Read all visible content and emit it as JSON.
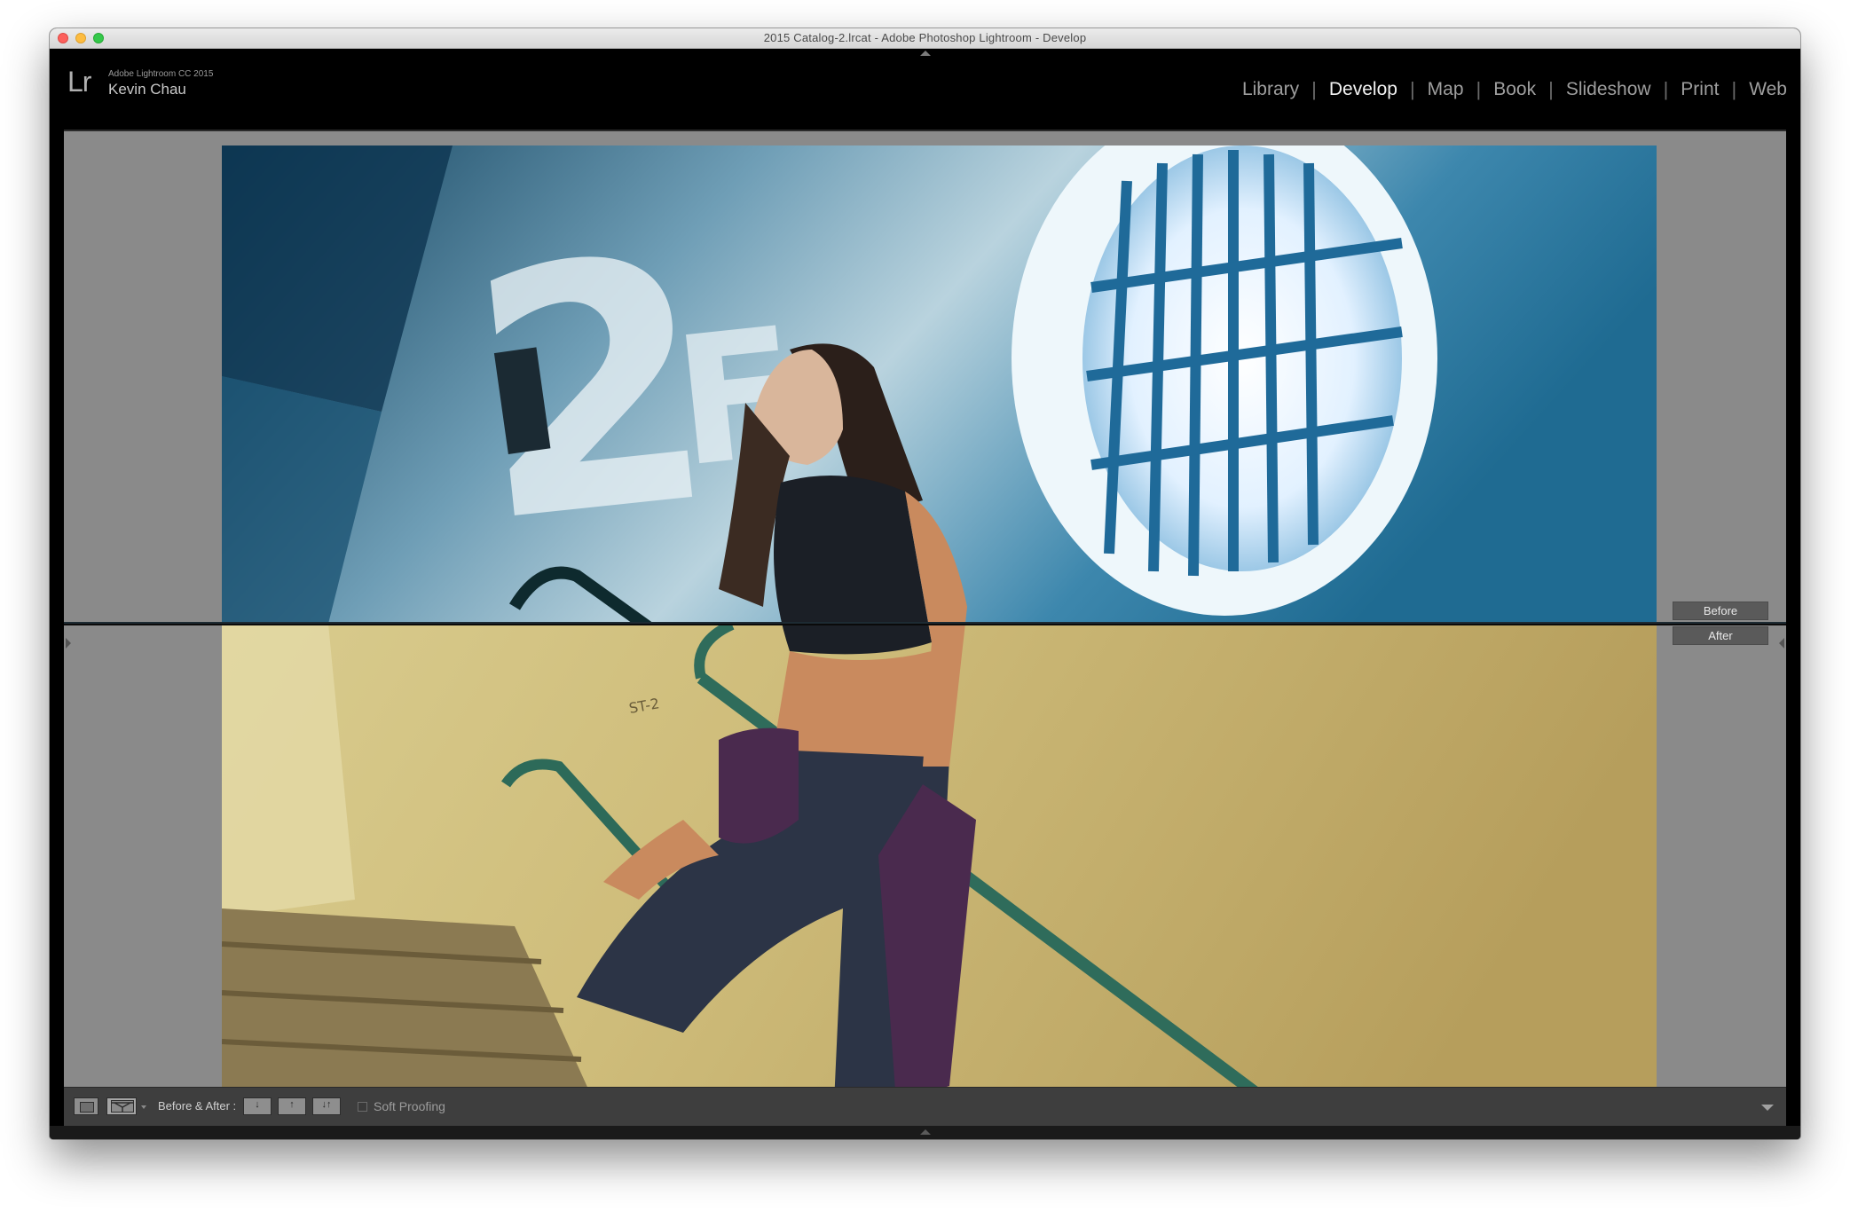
{
  "window": {
    "title": "2015 Catalog-2.lrcat - Adobe Photoshop Lightroom - Develop"
  },
  "identity_plate": {
    "logo": "Lr",
    "product": "Adobe Lightroom CC 2015",
    "user": "Kevin Chau"
  },
  "modules": {
    "items": [
      {
        "label": "Library",
        "active": false
      },
      {
        "label": "Develop",
        "active": true
      },
      {
        "label": "Map",
        "active": false
      },
      {
        "label": "Book",
        "active": false
      },
      {
        "label": "Slideshow",
        "active": false
      },
      {
        "label": "Print",
        "active": false
      },
      {
        "label": "Web",
        "active": false
      }
    ]
  },
  "compare": {
    "mode": "before-after-top-bottom-split",
    "before_label": "Before",
    "after_label": "After",
    "before_tone": "#1f6f93",
    "after_tone": "#c8b46a"
  },
  "toolbar": {
    "before_after_label": "Before & After :",
    "swap_buttons": [
      "copy-settings-before-to-after-icon",
      "copy-settings-after-to-before-icon",
      "swap-settings-icon"
    ],
    "soft_proofing_label": "Soft Proofing",
    "soft_proofing_checked": false
  }
}
